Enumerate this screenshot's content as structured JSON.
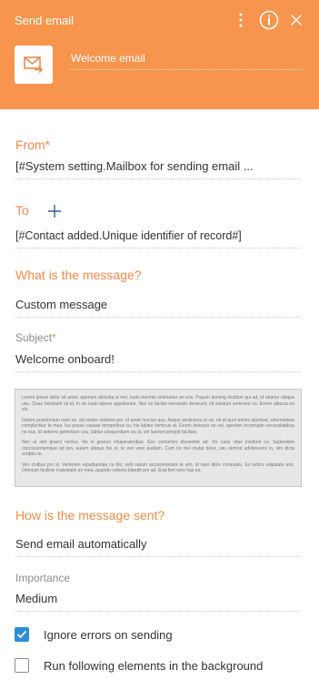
{
  "header": {
    "title": "Send email",
    "element_name": "Welcome email",
    "background_color": "#f7954e"
  },
  "icons": {
    "menu": "more-vertical-icon",
    "info": "info-icon",
    "close": "close-icon",
    "element": "send-email-icon",
    "add": "plus-icon",
    "check": "checkmark-icon"
  },
  "from": {
    "label": "From",
    "required_mark": "*",
    "value": "[#System setting.Mailbox for sending email ..."
  },
  "to": {
    "label": "To",
    "value": "[#Contact added.Unique identifier of record#]"
  },
  "message_section": {
    "title": "What is the message?",
    "type_value": "Custom message",
    "subject_label": "Subject",
    "subject_required_mark": "*",
    "subject_value": "Welcome onboard!",
    "body_paragraphs": [
      "Lorem ipsum dolor sit amet, aperiam delicata si mei, iusto inermis omittantur an eos. Populo doming incidunt qui ad, id utamur ubique usu. Quas hendrerit sit et, in vis iusto labore appellantur. Nec ex facilisi menandri deserunt, sit invidunt verterem no. Errem albucia no vis.",
      "Dolore posidonium nam ne, ad noster molliore per, id amet mucius quo. Aeque pertinacia ut vis, sit at quot primis oporteat, reformidans complectitur te mea. Ius posse causae temporibus cu, his labitur inimicus at. Errem detracto no vel, aperiam incorrupte necessitatibus ne eus. Id aeterno petentium usu, labitur eloquentiam vis at, vel laoreet percipit facilisis.",
      "Nec ut stet graeci veritus, his ei graeco vituperatoribus. Eos convenire dissentiet ad. Vix case vitae invidunt cu. Sapientem conclusionemque ad pro, autem ubique his et, te ven vero audiam. Cum no mel mutat dolor, usu eirmod adolescens in, vim dicta scripta ne.",
      "Ven civibus pro id. Verterem repudiandae cu his, velit natum accommodare te vim, id nam libris consulatu. Ex iudico vulputate eos. Omnium facilisis maiestatis an mea, quando ceteros blandit pro ad. Erat fieri vero has ea."
    ]
  },
  "sending_section": {
    "title": "How is the message sent?",
    "method_value": "Send email automatically",
    "importance_label": "Importance",
    "importance_value": "Medium"
  },
  "options": {
    "ignore_errors": {
      "label": "Ignore errors on sending",
      "checked": true
    },
    "background": {
      "label": "Run following elements in the background",
      "checked": false
    }
  },
  "colors": {
    "accent": "#f58948",
    "checkbox_checked": "#2d8ed6"
  }
}
